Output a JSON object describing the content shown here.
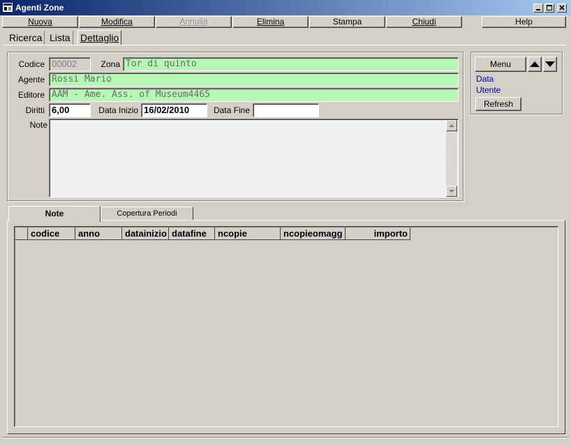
{
  "window": {
    "title": "Agenti Zone"
  },
  "toolbar": {
    "nuova": "Nuova",
    "modifica": "Modifica",
    "annulla": "Annulla",
    "elimina": "Elimina",
    "stampa": "Stampa",
    "chiudi": "Chiudi",
    "help": "Help"
  },
  "tabs": [
    "Ricerca",
    "Lista",
    "Dettaglio"
  ],
  "form": {
    "codice_label": "Codice",
    "codice_value": "00002",
    "zona_label": "Zona",
    "zona_value": "Tor di quinto",
    "agente_label": "Agente",
    "agente_value": "Rossi Mario",
    "editore_label": "Editore",
    "editore_value": "AAM - Ame. Ass. of Museum4465",
    "diritti_label": "Diritti",
    "diritti_value": "6,00",
    "data_inizio_label": "Data Inizio",
    "data_inizio_value": "16/02/2010",
    "data_fine_label": "Data Fine",
    "data_fine_value": "",
    "note_label": "Note",
    "note_value": ""
  },
  "side": {
    "menu": "Menu",
    "data": "Data",
    "utente": "Utente",
    "refresh": "Refresh"
  },
  "bottom_tabs": [
    "Note",
    "Copertura Periodi"
  ],
  "grid": {
    "columns": [
      "codice",
      "anno",
      "datainizio",
      "datafine",
      "ncopie",
      "ncopieomagg",
      "importo"
    ]
  },
  "colors": {
    "titlebar": "#0a246a",
    "field_green": "#b7f7b6",
    "link_blue": "#0000c0"
  }
}
